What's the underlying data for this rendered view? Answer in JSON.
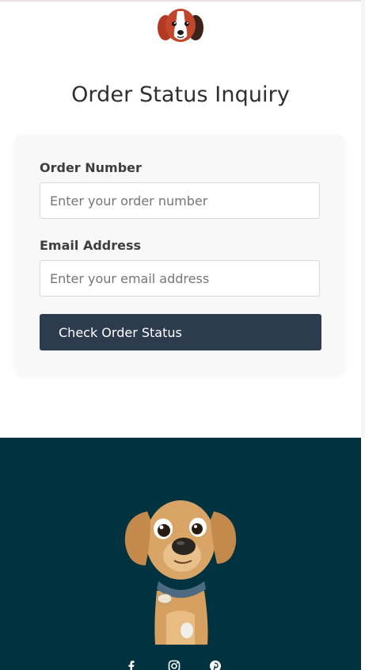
{
  "header": {
    "logo_icon": "beagle-head-icon"
  },
  "page": {
    "title": "Order Status Inquiry"
  },
  "form": {
    "order_number_label": "Order Number",
    "order_number_placeholder": "Enter your order number",
    "order_number_value": "",
    "email_label": "Email Address",
    "email_placeholder": "Enter your email address",
    "email_value": "",
    "submit_label": "Check Order Status"
  },
  "footer": {
    "mascot_icon": "cartoon-dog-icon",
    "social_icons": [
      "facebook-icon",
      "instagram-icon",
      "pinterest-icon"
    ]
  },
  "colors": {
    "button_bg": "#2c3b4e",
    "footer_bg": "#013240",
    "card_bg": "#f8f8f8"
  }
}
